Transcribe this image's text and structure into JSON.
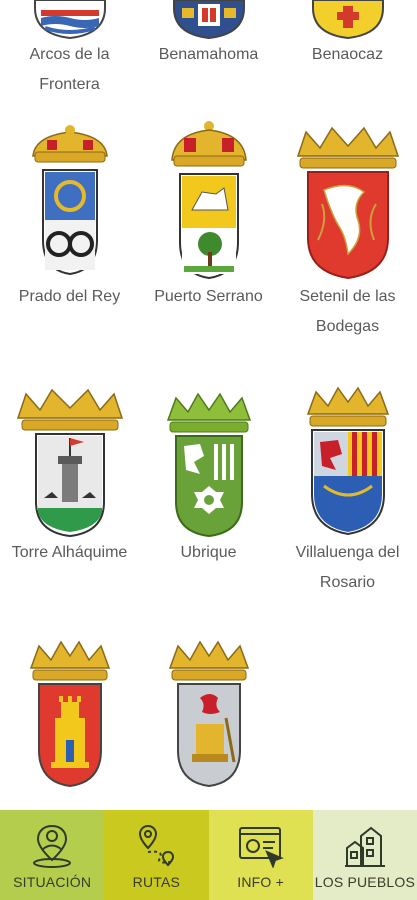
{
  "towns": [
    {
      "id": "arcos",
      "lines": [
        "Arcos de la",
        "Frontera"
      ]
    },
    {
      "id": "benamahoma",
      "lines": [
        "Benamahoma"
      ]
    },
    {
      "id": "benaocaz",
      "lines": [
        "Benaocaz"
      ]
    },
    {
      "id": "prado",
      "lines": [
        "Prado del Rey"
      ]
    },
    {
      "id": "puerto",
      "lines": [
        "Puerto Serrano"
      ]
    },
    {
      "id": "setenil",
      "lines": [
        "Setenil de las",
        "Bodegas"
      ]
    },
    {
      "id": "torre",
      "lines": [
        "Torre Alháquime"
      ]
    },
    {
      "id": "ubrique",
      "lines": [
        "Ubrique"
      ]
    },
    {
      "id": "villaluenga",
      "lines": [
        "Villaluenga del",
        "Rosario"
      ]
    },
    {
      "id": "zahara",
      "lines": []
    },
    {
      "id": "elbosque",
      "lines": []
    }
  ],
  "nav": [
    {
      "id": "situacion",
      "label": "SITUACIÓN",
      "icon": "location-person-icon",
      "bg": "#b5cd4c"
    },
    {
      "id": "rutas",
      "label": "RUTAS",
      "icon": "route-map-icon",
      "bg": "#c9c91f"
    },
    {
      "id": "info",
      "label": "INFO +",
      "icon": "browser-info-icon",
      "bg": "#dfe052"
    },
    {
      "id": "pueblos",
      "label": "LOS PUEBLOS",
      "icon": "village-houses-icon",
      "bg": "#e3ebc7"
    }
  ],
  "colors": {
    "label_text": "#5a5a5a",
    "gold": "#e6b92b",
    "red": "#e03a2e",
    "green": "#6aa23a"
  }
}
